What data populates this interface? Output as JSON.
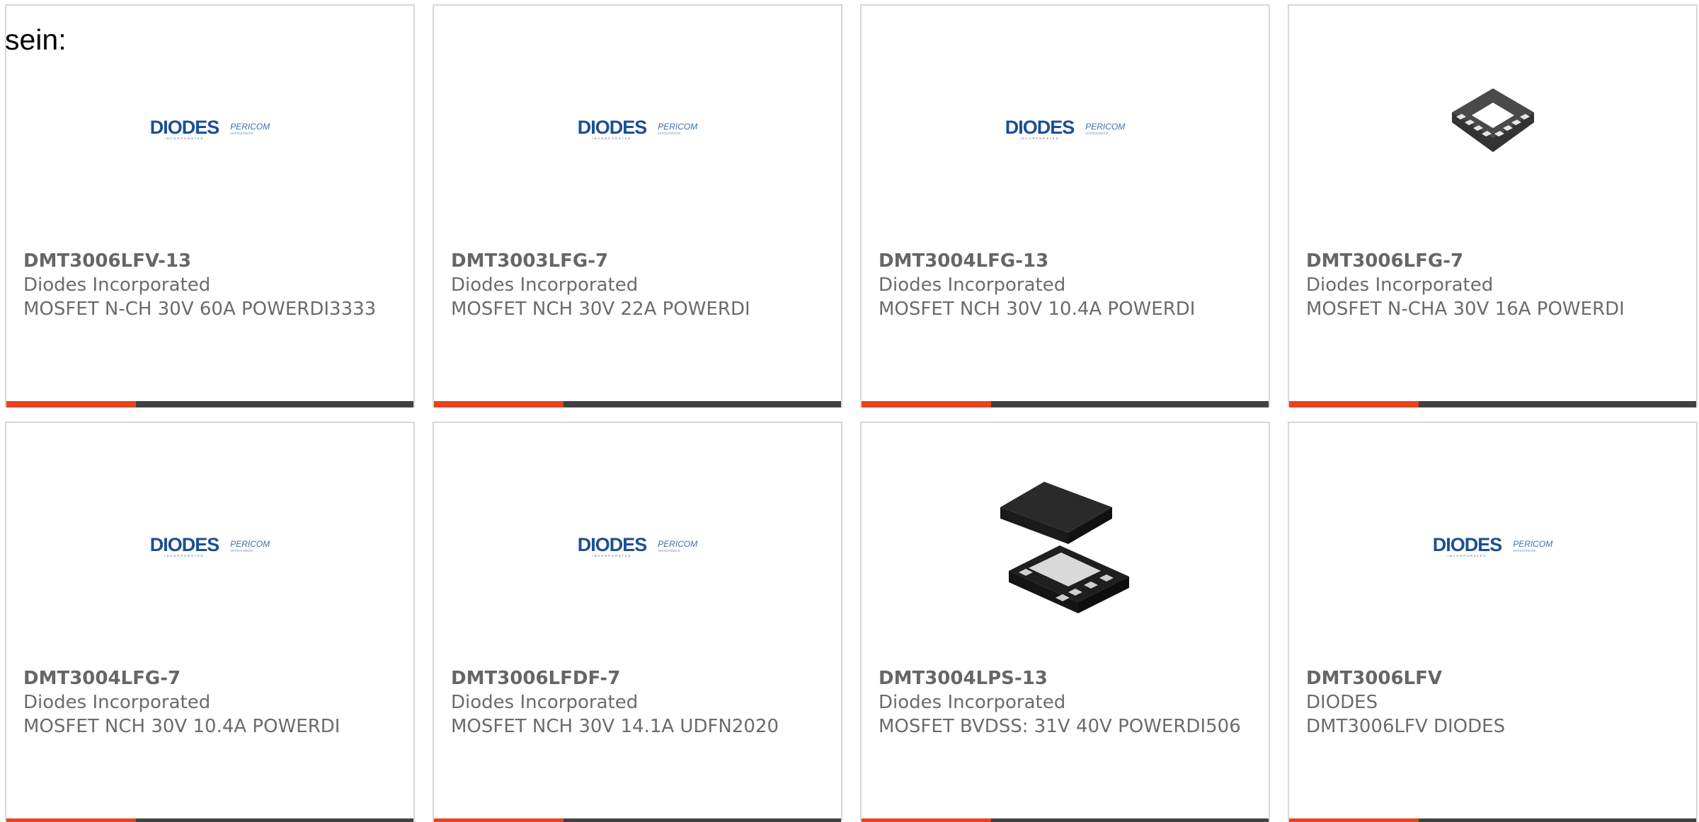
{
  "heading": "sein:",
  "logo": {
    "primary": "DIODES",
    "primary_sub": "INCORPORATED",
    "secondary": "PERICOM",
    "secondary_sub": "semiconductor"
  },
  "colors": {
    "accent": "#e8431a",
    "bar_dark": "#414141",
    "card_border": "#d7d7d7",
    "text": "#6b6b6b",
    "logo_blue": "#1b4f93"
  },
  "products": [
    {
      "part_number": "DMT3006LFV-13",
      "manufacturer": "Diodes Incorporated",
      "description": "MOSFET N-CH 30V 60A POWERDI3333",
      "image": "diodes-pericom-logo"
    },
    {
      "part_number": "DMT3003LFG-7",
      "manufacturer": "Diodes Incorporated",
      "description": "MOSFET NCH 30V 22A POWERDI",
      "image": "diodes-pericom-logo"
    },
    {
      "part_number": "DMT3004LFG-13",
      "manufacturer": "Diodes Incorporated",
      "description": "MOSFET NCH 30V 10.4A POWERDI",
      "image": "diodes-pericom-logo"
    },
    {
      "part_number": "DMT3006LFG-7",
      "manufacturer": "Diodes Incorporated",
      "description": "MOSFET N-CHA 30V 16A POWERDI",
      "image": "chip-package-photo"
    },
    {
      "part_number": "DMT3004LFG-7",
      "manufacturer": "Diodes Incorporated",
      "description": "MOSFET NCH 30V 10.4A POWERDI",
      "image": "diodes-pericom-logo"
    },
    {
      "part_number": "DMT3006LFDF-7",
      "manufacturer": "Diodes Incorporated",
      "description": "MOSFET NCH 30V 14.1A UDFN2020",
      "image": "diodes-pericom-logo"
    },
    {
      "part_number": "DMT3004LPS-13",
      "manufacturer": "Diodes Incorporated",
      "description": "MOSFET BVDSS: 31V 40V POWERDI506",
      "image": "powerdi-package-photo"
    },
    {
      "part_number": "DMT3006LFV",
      "manufacturer": "DIODES",
      "description": "DMT3006LFV DIODES",
      "image": "diodes-pericom-logo"
    }
  ]
}
